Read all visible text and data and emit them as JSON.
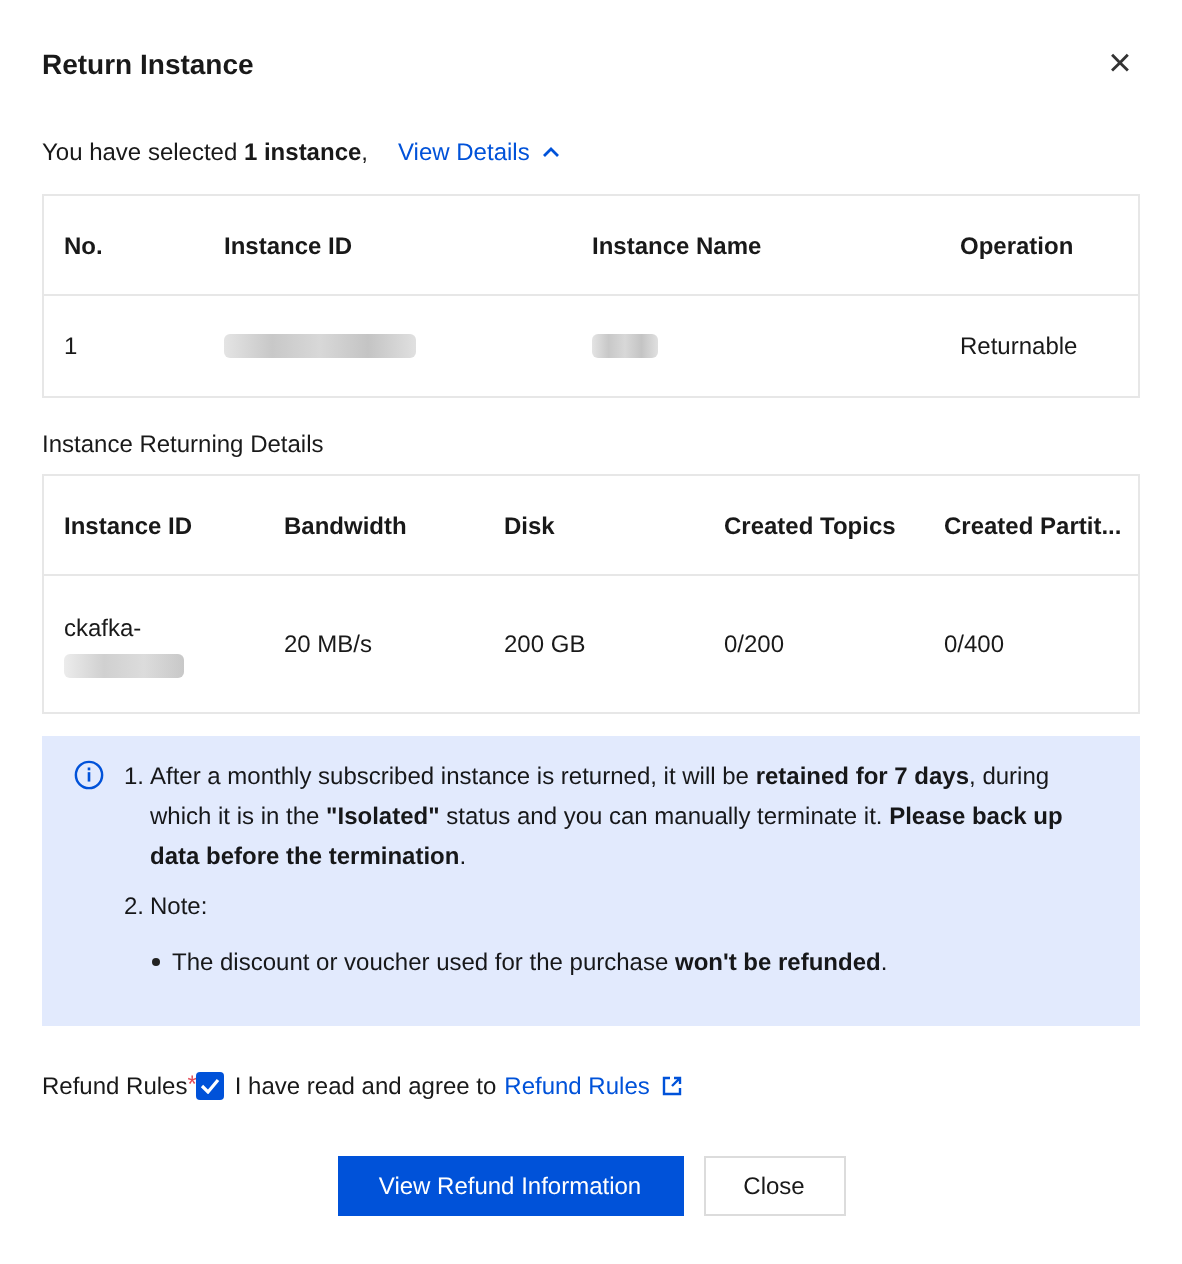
{
  "dialog": {
    "title": "Return Instance",
    "close_icon": "×"
  },
  "selection": {
    "text": "You have selected **1 instance**,",
    "link": "View Details",
    "expanded": true
  },
  "instances_table": {
    "columns": [
      "No.",
      "Instance ID",
      "Instance Name",
      "Operation"
    ],
    "rows": [
      [
        {
          "kind": "text",
          "text": "1"
        },
        {
          "kind": "redacted_long"
        },
        {
          "kind": "redacted_short"
        },
        {
          "kind": "text",
          "text": "Returnable"
        }
      ]
    ]
  },
  "details_title": "Instance Returning Details",
  "details_table": {
    "columns": [
      "Instance ID",
      "Bandwidth",
      "Disk",
      "Created Topics",
      "Created Partit..."
    ],
    "rows": [
      [
        {
          "kind": "prefix_redacted",
          "text": "ckafka-"
        },
        {
          "kind": "text",
          "text": "20 MB/s"
        },
        {
          "kind": "text",
          "text": "200 GB"
        },
        {
          "kind": "text",
          "text": "0/200"
        },
        {
          "kind": "text",
          "text": "0/400"
        }
      ]
    ]
  },
  "notice": {
    "items": [
      {
        "kind": "numbered",
        "number": "1.",
        "text": "After a monthly subscribed instance is returned, it will be **retained for 7 days**, during which it is in the **\"Isolated\"** status and you can manually terminate it. **Please back up data before the termination**."
      },
      {
        "kind": "numbered",
        "number": "2.",
        "text": "Note:"
      },
      {
        "kind": "bullet",
        "text": "The discount or voucher used for the purchase **won't be refunded**."
      }
    ]
  },
  "refund_rules": {
    "label": "Refund Rules",
    "required_mark": "*",
    "checked": true,
    "text": "I have read and agree to",
    "link": "Refund Rules"
  },
  "buttons": [
    {
      "label": "View Refund Information",
      "kind": "primary"
    },
    {
      "label": "Close",
      "kind": "secondary"
    }
  ]
}
